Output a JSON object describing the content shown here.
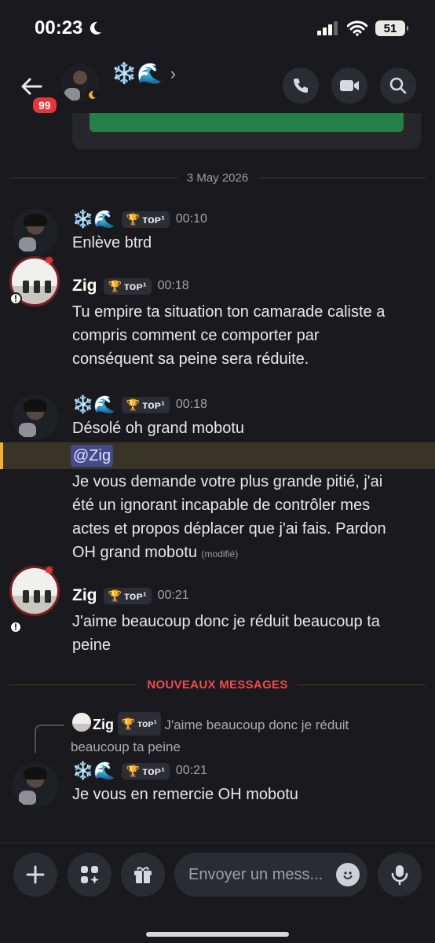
{
  "status_bar": {
    "time": "00:23",
    "battery": "51"
  },
  "header": {
    "unread_badge": "99",
    "channel_name": "❄️🌊",
    "chevron": "›"
  },
  "date_divider": "3 May 2026",
  "new_messages_divider": "NOUVEAUX MESSAGES",
  "role_tag": {
    "label": "ᴛᴏᴘ¹",
    "icon": "🏆"
  },
  "messages": [
    {
      "author": "❄️🌊",
      "time": "00:10",
      "lines": [
        "Enlève btrd"
      ]
    },
    {
      "author": "Zig",
      "time": "00:18",
      "lines": [
        "Tu empire ta situation ton camarade caliste a",
        "compris comment ce comporter par",
        "conséquent sa peine sera réduite."
      ]
    },
    {
      "author": "❄️🌊",
      "time": "00:18",
      "first_line": "Désolé oh grand mobotu",
      "mention": "@Zig",
      "lines": [
        "Je vous demande votre plus grande pitié, j'ai",
        "été un ignorant incapable de contrôler mes",
        "actes et propos déplacer que j'ai fais. Pardon"
      ],
      "last_line": "OH grand mobotu",
      "edited": "(modifié)"
    },
    {
      "author": "Zig",
      "time": "00:21",
      "lines": [
        "J'aime beaucoup donc je réduit beaucoup ta",
        "peine"
      ]
    },
    {
      "author": "❄️🌊",
      "time": "00:21",
      "lines": [
        "Je vous en remercie OH mobotu"
      ],
      "reply": {
        "author": "Zig",
        "text_line1": "J'aime beaucoup donc je réduit",
        "text_line2": "beaucoup ta peine"
      }
    }
  ],
  "composer": {
    "placeholder": "Envoyer un mess..."
  },
  "colors": {
    "accent_red": "#f04b50",
    "mention_bg": "#454a8a",
    "highlight_bar": "#f0b232",
    "green_button": "#248046"
  }
}
